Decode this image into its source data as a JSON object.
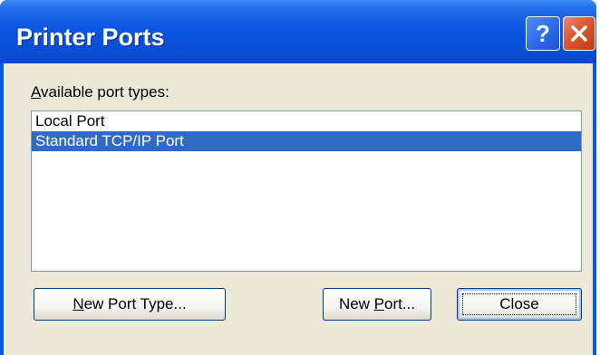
{
  "window": {
    "title": "Printer Ports",
    "help_icon": "help-icon",
    "close_icon": "close-icon",
    "accent": "#0a5be0"
  },
  "dialog": {
    "port_types_label_mnemonic": "A",
    "port_types_label_rest": "vailable port types:",
    "port_types": [
      {
        "label": "Local Port",
        "selected": false
      },
      {
        "label": "Standard TCP/IP Port",
        "selected": true
      }
    ],
    "selection_color": "#316ac5",
    "buttons": {
      "new_port_type_mnemonic": "N",
      "new_port_type_rest": "ew Port Type...",
      "new_port_pre": "New ",
      "new_port_mnemonic": "P",
      "new_port_rest": "ort...",
      "close": "Close"
    }
  }
}
